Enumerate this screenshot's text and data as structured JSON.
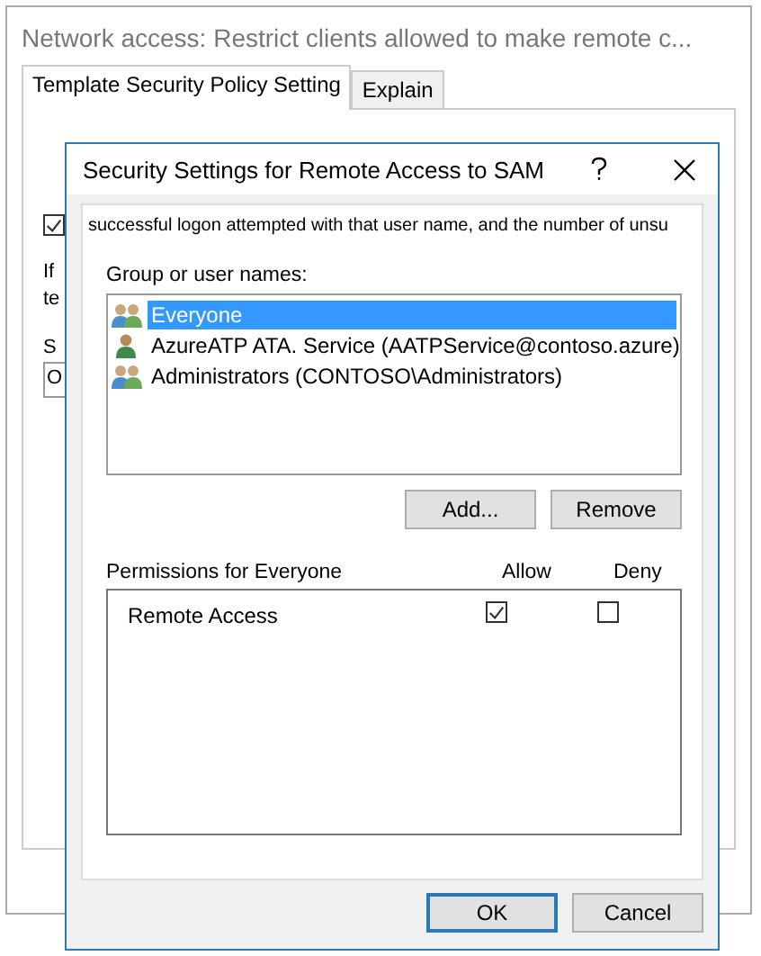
{
  "back_window": {
    "title": "Network access: Restrict clients allowed to make remote c...",
    "tabs": [
      {
        "label": "Template Security Policy Setting",
        "selected": true
      },
      {
        "label": "Explain",
        "selected": false
      }
    ],
    "checkbox": {
      "checked": true
    },
    "fragments": [
      "If",
      "te"
    ],
    "setting_label": "S",
    "setting_value": "O"
  },
  "dialog": {
    "title": "Security Settings for Remote Access to SAM",
    "description": "successful logon attempted with that user name, and the number of unsu",
    "group_label": "Group or user names:",
    "principals": [
      {
        "name": "Everyone",
        "kind": "group",
        "selected": true
      },
      {
        "name": "AzureATP ATA. Service (AATPService@contoso.azure)",
        "kind": "user",
        "selected": false
      },
      {
        "name": "Administrators (CONTOSO\\Administrators)",
        "kind": "group",
        "selected": false
      }
    ],
    "add_button": "Add...",
    "remove_button": "Remove",
    "permissions_label": "Permissions for Everyone",
    "allow_label": "Allow",
    "deny_label": "Deny",
    "permissions": [
      {
        "name": "Remote Access",
        "allow": true,
        "deny": false
      }
    ],
    "ok_button": "OK",
    "cancel_button": "Cancel"
  }
}
